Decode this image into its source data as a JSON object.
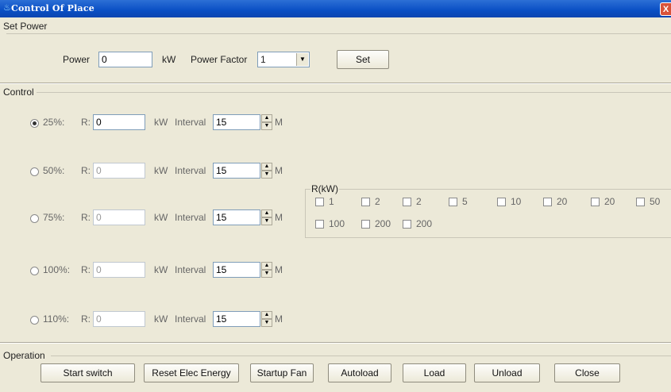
{
  "window": {
    "title": "Control Of Place",
    "close_glyph": "X"
  },
  "set_power": {
    "legend": "Set Power",
    "power_label": "Power",
    "power_value": "0",
    "power_unit": "kW",
    "pf_label": "Power Factor",
    "pf_value": "1",
    "set_button": "Set"
  },
  "control": {
    "legend": "Control",
    "rows": [
      {
        "percent": "25%:",
        "r_label": "R:",
        "r_value": "0",
        "unit": "kW",
        "interval_label": "Interval",
        "interval_value": "15",
        "m_label": "M",
        "selected": true
      },
      {
        "percent": "50%:",
        "r_label": "R:",
        "r_value": "0",
        "unit": "kW",
        "interval_label": "Interval",
        "interval_value": "15",
        "m_label": "M",
        "selected": false
      },
      {
        "percent": "75%:",
        "r_label": "R:",
        "r_value": "0",
        "unit": "kW",
        "interval_label": "Interval",
        "interval_value": "15",
        "m_label": "M",
        "selected": false
      },
      {
        "percent": "100%:",
        "r_label": "R:",
        "r_value": "0",
        "unit": "kW",
        "interval_label": "Interval",
        "interval_value": "15",
        "m_label": "M",
        "selected": false
      },
      {
        "percent": "110%:",
        "r_label": "R:",
        "r_value": "0",
        "unit": "kW",
        "interval_label": "Interval",
        "interval_value": "15",
        "m_label": "M",
        "selected": false
      }
    ],
    "rkw": {
      "legend": "R(kW)",
      "items": [
        "1",
        "2",
        "2",
        "5",
        "10",
        "20",
        "20",
        "50",
        "100",
        "200",
        "200"
      ]
    }
  },
  "operation": {
    "legend": "Operation",
    "buttons": [
      "Start switch",
      "Reset Elec Energy",
      "Startup Fan",
      "Autoload",
      "Load",
      "Unload",
      "Close"
    ]
  }
}
